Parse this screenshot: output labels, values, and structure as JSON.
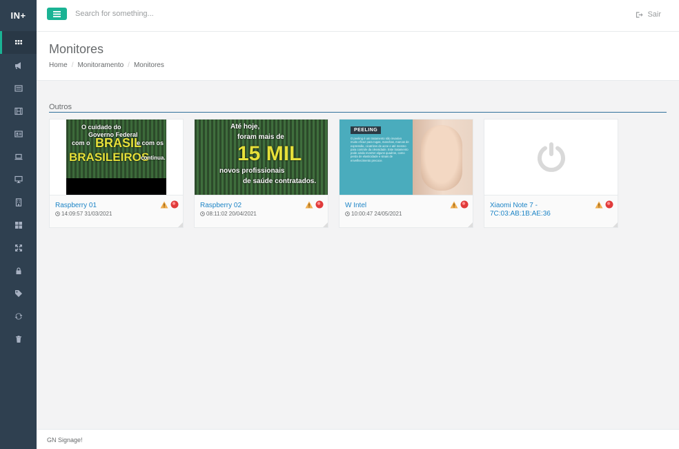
{
  "brand": "IN+",
  "sidebar": {
    "items": [
      {
        "icon": "grid-icon",
        "active": true
      },
      {
        "icon": "bullhorn-icon"
      },
      {
        "icon": "list-icon"
      },
      {
        "icon": "film-icon"
      },
      {
        "icon": "id-card-icon"
      },
      {
        "icon": "laptop-icon"
      },
      {
        "icon": "desktop-icon"
      },
      {
        "icon": "building-icon"
      },
      {
        "icon": "th-large-icon"
      },
      {
        "icon": "expand-icon"
      },
      {
        "icon": "lock-icon"
      },
      {
        "icon": "tag-icon"
      },
      {
        "icon": "refresh-icon"
      },
      {
        "icon": "trash-icon"
      }
    ]
  },
  "topbar": {
    "search_placeholder": "Search for something...",
    "logout_label": "Sair"
  },
  "page": {
    "title": "Monitores",
    "breadcrumb": [
      "Home",
      "Monitoramento",
      "Monitores"
    ]
  },
  "section": {
    "title": "Outros"
  },
  "monitors": [
    {
      "name": "Raspberry 01",
      "time": "14:09:57 31/03/2021",
      "thumb_text": [
        "O cuidado do",
        "Governo Federal",
        "com o",
        "BRASIL",
        "e com os",
        "BRASILEIROS",
        "continua."
      ]
    },
    {
      "name": "Raspberry 02",
      "time": "08:11:02 20/04/2021",
      "thumb_text": [
        "Até hoje,",
        "foram mais de",
        "15 MIL",
        "novos profissionais",
        "de saúde contratados."
      ]
    },
    {
      "name": "W Intel",
      "time": "10:00:47 24/05/2021",
      "thumb_text": [
        "PEELING",
        "O peeling é um tratamento não invasivo muito eficaz para rugas, manchas, marcas de expressão, cicatrizes de acne e até mesmo para controle da oleosidade. Este tratamento pode ainda reverter alguns quadros, como perda de elasticidade e sinais de envelhecimento precoce."
      ]
    },
    {
      "name": "Xiaomi Note 7 - 7C:03:AB:1B:AE:36",
      "time": ""
    }
  ],
  "footer": {
    "text": "GN Signage!"
  },
  "colors": {
    "sidebar_bg": "#2f4050",
    "accent": "#1ab394",
    "link": "#1c84c6",
    "warning": "#f0ad4e",
    "danger": "#ed5565"
  }
}
